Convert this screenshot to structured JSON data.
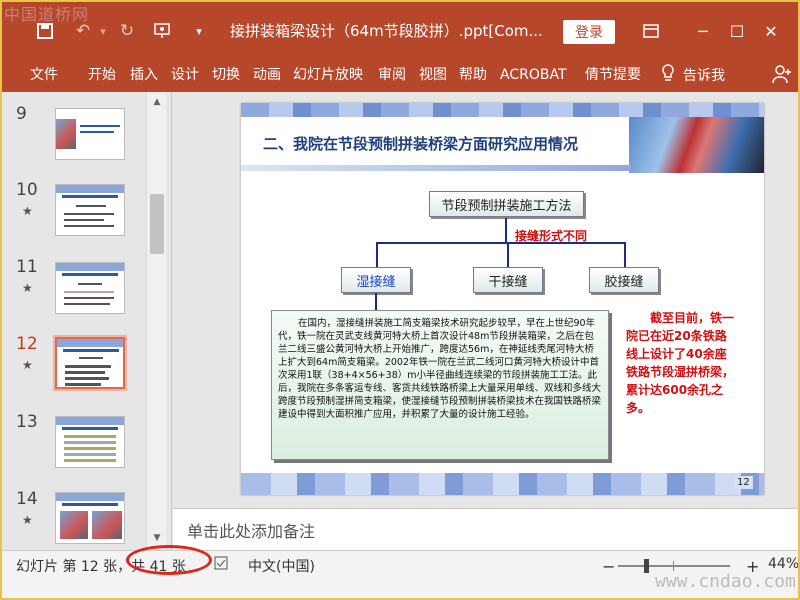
{
  "watermark_top": "中国道桥网",
  "titlebar": {
    "title": "接拼装箱梁设计（64m节段胶拼）.ppt[Com...",
    "login": "登录"
  },
  "ribbon": {
    "tabs": [
      "文件",
      "开始",
      "插入",
      "设计",
      "切换",
      "动画",
      "幻灯片放映",
      "审阅",
      "视图",
      "帮助",
      "ACROBAT",
      "倩节提要"
    ],
    "tell_me": "告诉我"
  },
  "thumbnails": [
    {
      "num": "9",
      "star": ""
    },
    {
      "num": "10",
      "star": "★"
    },
    {
      "num": "11",
      "star": "★"
    },
    {
      "num": "12",
      "star": "★",
      "active": true
    },
    {
      "num": "13",
      "star": ""
    },
    {
      "num": "14",
      "star": "★"
    }
  ],
  "slide": {
    "title": "二、我院在节段预制拼装桥梁方面研究应用情况",
    "top_box": "节段预制拼装施工方法",
    "connector_label": "接缝形式不同",
    "box_wet": "湿接缝",
    "box_dry": "干接缝",
    "box_glue": "胶接缝",
    "body_text": "在国内，湿接缝拼装施工简支箱梁技术研究起步较早，早在上世纪90年代，铁一院在灵武支线黄河特大桥上首次设计48m节段拼装箱梁，之后在包兰二线三盛公黄河特大桥上开始推广，跨度达56m，在神延线秃尾河特大桥上扩大到64m简支箱梁。2002年铁一院在兰武二线河口黄河特大桥设计中首次采用1联（38+4×56+38）m小半径曲线连续梁的节段拼装施工工法。此后，我院在多条客运专线、客货共线铁路桥梁上大量采用单线、双线和多线大跨度节段预制湿拼简支箱梁，使湿接缝节段预制拼装桥梁技术在我国铁路桥梁建设中得到大面积推广应用，并积累了大量的设计施工经验。",
    "side_note": "截至目前，铁一院已在近20条铁路线上设计了40余座铁路节段湿拼桥梁，累计达600余孔之多。",
    "page_number": "12"
  },
  "notes": {
    "placeholder": "单击此处添加备注"
  },
  "status": {
    "slide_info_a": "幻灯片 第 12 张，",
    "slide_info_b": "共 41 张",
    "language": "中文(中国)",
    "zoom_minus": "−",
    "zoom_plus": "+",
    "zoom_level": "44%"
  },
  "watermark_bottom": "www.cndao.com",
  "colors": {
    "accent": "#b7472a",
    "highlight": "#e0241a",
    "slide_title": "#1f3f7d"
  }
}
